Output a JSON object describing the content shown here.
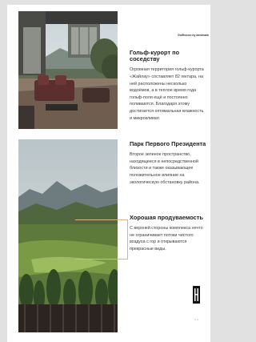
{
  "brand": "Golfhouse by landmark",
  "sections": [
    {
      "title": "Гольф-курорт по соседству",
      "text": "Огромная территория гольф-курорта «Жайлау» составляет 82 гектара, на ней расположены несколько водоёмов, а в теплое время года гольф-поля ещё и постоянно поливаются. Благодаря этому достигается оптимальная влажность и микроклимат."
    },
    {
      "title": "Парк Первого Президента",
      "text": "Второе зеленое пространство, находящееся в непосредственной близости и также оказывающее положительное влияние на экологическую обстановку района."
    },
    {
      "title": "Хорошая продуваемость",
      "text": "С верхней стороны комплекса нечто не ограничивает потоки чистого воздуха с гор и открываются прекрасные виды."
    }
  ],
  "page_number": "•• ••",
  "images": [
    "terrace-lounge-photo",
    "mountain-golf-valley-photo"
  ],
  "colors": {
    "accent": "#d9b784",
    "page": "#ffffff",
    "background": "#e1e1e1"
  }
}
